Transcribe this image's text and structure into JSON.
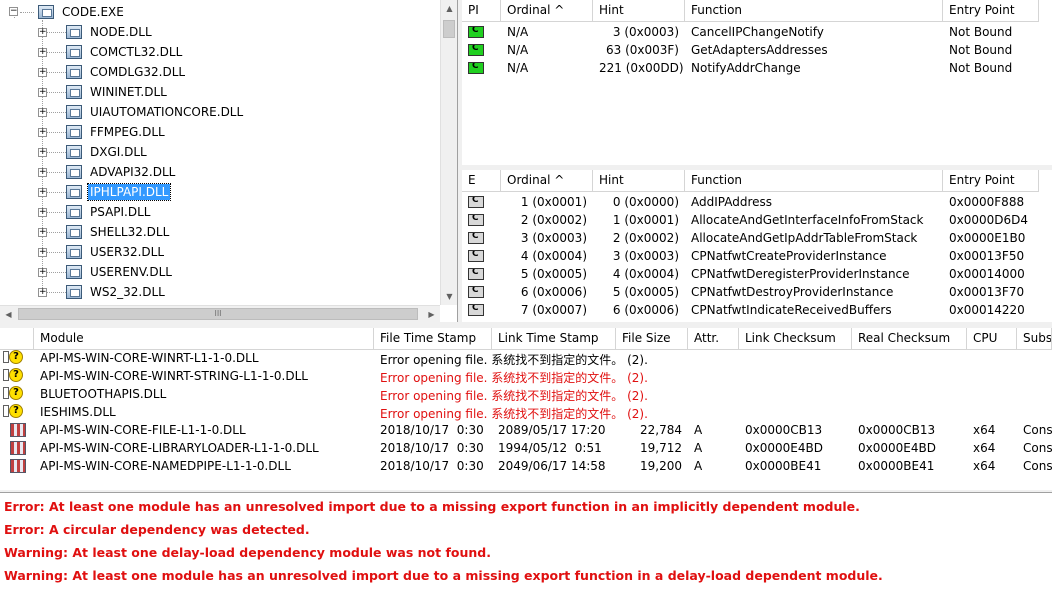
{
  "tree": {
    "root": "CODE.EXE",
    "items": [
      "NODE.DLL",
      "COMCTL32.DLL",
      "COMDLG32.DLL",
      "WININET.DLL",
      "UIAUTOMATIONCORE.DLL",
      "FFMPEG.DLL",
      "DXGI.DLL",
      "ADVAPI32.DLL",
      "IPHLPAPI.DLL",
      "PSAPI.DLL",
      "SHELL32.DLL",
      "USER32.DLL",
      "USERENV.DLL",
      "WS2_32.DLL"
    ],
    "selected_index": 8,
    "expander_symbol": "+",
    "hscroll_thumb_glyph": "III"
  },
  "imports": {
    "headers": [
      "PI",
      "Ordinal ^",
      "Hint",
      "Function",
      "Entry Point"
    ],
    "rows": [
      {
        "ordinal": "N/A",
        "hint": "3 (0x0003)",
        "function": "CancelIPChangeNotify",
        "entry": "Not Bound"
      },
      {
        "ordinal": "N/A",
        "hint": "63 (0x003F)",
        "function": "GetAdaptersAddresses",
        "entry": "Not Bound"
      },
      {
        "ordinal": "N/A",
        "hint": "221 (0x00DD)",
        "function": "NotifyAddrChange",
        "entry": "Not Bound"
      }
    ]
  },
  "exports": {
    "headers": [
      "E",
      "Ordinal ^",
      "Hint",
      "Function",
      "Entry Point"
    ],
    "rows": [
      {
        "ordinal": "1 (0x0001)",
        "hint": "0 (0x0000)",
        "function": "AddIPAddress",
        "entry": "0x0000F888"
      },
      {
        "ordinal": "2 (0x0002)",
        "hint": "1 (0x0001)",
        "function": "AllocateAndGetInterfaceInfoFromStack",
        "entry": "0x0000D6D4"
      },
      {
        "ordinal": "3 (0x0003)",
        "hint": "2 (0x0002)",
        "function": "AllocateAndGetIpAddrTableFromStack",
        "entry": "0x0000E1B0"
      },
      {
        "ordinal": "4 (0x0004)",
        "hint": "3 (0x0003)",
        "function": "CPNatfwtCreateProviderInstance",
        "entry": "0x00013F50"
      },
      {
        "ordinal": "5 (0x0005)",
        "hint": "4 (0x0004)",
        "function": "CPNatfwtDeregisterProviderInstance",
        "entry": "0x00014000"
      },
      {
        "ordinal": "6 (0x0006)",
        "hint": "5 (0x0005)",
        "function": "CPNatfwtDestroyProviderInstance",
        "entry": "0x00013F70"
      },
      {
        "ordinal": "7 (0x0007)",
        "hint": "6 (0x0006)",
        "function": "CPNatfwtIndicateReceivedBuffers",
        "entry": "0x00014220"
      }
    ]
  },
  "modules": {
    "headers": [
      "",
      "Module",
      "File Time Stamp",
      "Link Time Stamp",
      "File Size",
      "Attr.",
      "Link Checksum",
      "Real Checksum",
      "CPU",
      "Subs"
    ],
    "missing": [
      {
        "module": "API-MS-WIN-CORE-WINRT-L1-1-0.DLL",
        "error": "Error opening file. 系统找不到指定的文件。 (2).",
        "red": false
      },
      {
        "module": "API-MS-WIN-CORE-WINRT-STRING-L1-1-0.DLL",
        "error": "Error opening file. 系统找不到指定的文件。 (2).",
        "red": true
      },
      {
        "module": "BLUETOOTHAPIS.DLL",
        "error": "Error opening file. 系统找不到指定的文件。 (2).",
        "red": true
      },
      {
        "module": "IESHIMS.DLL",
        "error": "Error opening file. 系统找不到指定的文件。 (2).",
        "red": true
      }
    ],
    "found": [
      {
        "module": "API-MS-WIN-CORE-FILE-L1-1-0.DLL",
        "file_ts": "2018/10/17  0:30",
        "link_ts": "2089/05/17 17:20",
        "size": "22,784",
        "attr": "A",
        "link_ck": "0x0000CB13",
        "real_ck": "0x0000CB13",
        "cpu": "x64",
        "subs": "Cons"
      },
      {
        "module": "API-MS-WIN-CORE-LIBRARYLOADER-L1-1-0.DLL",
        "file_ts": "2018/10/17  0:30",
        "link_ts": "1994/05/12  0:51",
        "size": "19,712",
        "attr": "A",
        "link_ck": "0x0000E4BD",
        "real_ck": "0x0000E4BD",
        "cpu": "x64",
        "subs": "Cons"
      },
      {
        "module": "API-MS-WIN-CORE-NAMEDPIPE-L1-1-0.DLL",
        "file_ts": "2018/10/17  0:30",
        "link_ts": "2049/06/17 14:58",
        "size": "19,200",
        "attr": "A",
        "link_ck": "0x0000BE41",
        "real_ck": "0x0000BE41",
        "cpu": "x64",
        "subs": "Cons"
      }
    ]
  },
  "log": [
    "Error: At least one module has an unresolved import due to a missing export function in an implicitly dependent module.",
    "Error: A circular dependency was detected.",
    "Warning: At least one delay-load dependency module was not found.",
    "Warning: At least one module has an unresolved import due to a missing export function in a delay-load dependent module."
  ]
}
